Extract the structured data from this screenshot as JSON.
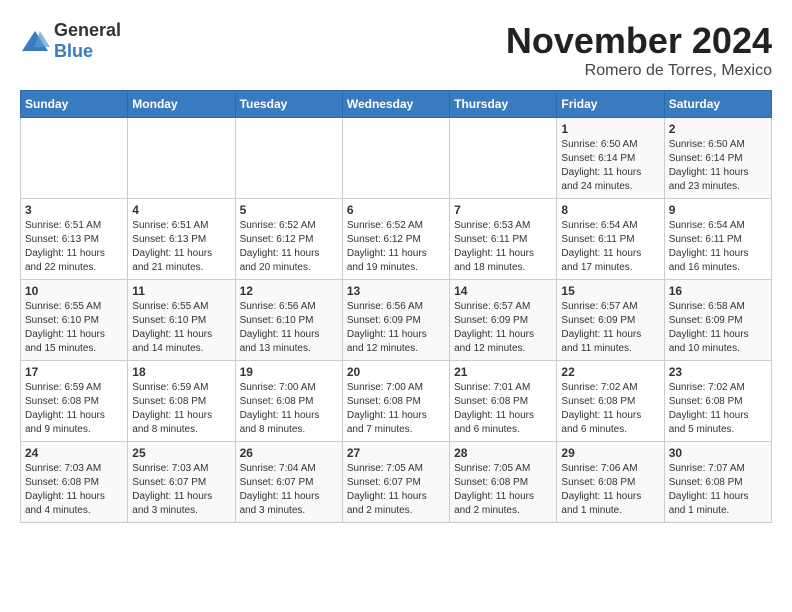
{
  "header": {
    "logo_general": "General",
    "logo_blue": "Blue",
    "month": "November 2024",
    "location": "Romero de Torres, Mexico"
  },
  "days_of_week": [
    "Sunday",
    "Monday",
    "Tuesday",
    "Wednesday",
    "Thursday",
    "Friday",
    "Saturday"
  ],
  "weeks": [
    [
      {
        "day": "",
        "info": ""
      },
      {
        "day": "",
        "info": ""
      },
      {
        "day": "",
        "info": ""
      },
      {
        "day": "",
        "info": ""
      },
      {
        "day": "",
        "info": ""
      },
      {
        "day": "1",
        "info": "Sunrise: 6:50 AM\nSunset: 6:14 PM\nDaylight: 11 hours and 24 minutes."
      },
      {
        "day": "2",
        "info": "Sunrise: 6:50 AM\nSunset: 6:14 PM\nDaylight: 11 hours and 23 minutes."
      }
    ],
    [
      {
        "day": "3",
        "info": "Sunrise: 6:51 AM\nSunset: 6:13 PM\nDaylight: 11 hours and 22 minutes."
      },
      {
        "day": "4",
        "info": "Sunrise: 6:51 AM\nSunset: 6:13 PM\nDaylight: 11 hours and 21 minutes."
      },
      {
        "day": "5",
        "info": "Sunrise: 6:52 AM\nSunset: 6:12 PM\nDaylight: 11 hours and 20 minutes."
      },
      {
        "day": "6",
        "info": "Sunrise: 6:52 AM\nSunset: 6:12 PM\nDaylight: 11 hours and 19 minutes."
      },
      {
        "day": "7",
        "info": "Sunrise: 6:53 AM\nSunset: 6:11 PM\nDaylight: 11 hours and 18 minutes."
      },
      {
        "day": "8",
        "info": "Sunrise: 6:54 AM\nSunset: 6:11 PM\nDaylight: 11 hours and 17 minutes."
      },
      {
        "day": "9",
        "info": "Sunrise: 6:54 AM\nSunset: 6:11 PM\nDaylight: 11 hours and 16 minutes."
      }
    ],
    [
      {
        "day": "10",
        "info": "Sunrise: 6:55 AM\nSunset: 6:10 PM\nDaylight: 11 hours and 15 minutes."
      },
      {
        "day": "11",
        "info": "Sunrise: 6:55 AM\nSunset: 6:10 PM\nDaylight: 11 hours and 14 minutes."
      },
      {
        "day": "12",
        "info": "Sunrise: 6:56 AM\nSunset: 6:10 PM\nDaylight: 11 hours and 13 minutes."
      },
      {
        "day": "13",
        "info": "Sunrise: 6:56 AM\nSunset: 6:09 PM\nDaylight: 11 hours and 12 minutes."
      },
      {
        "day": "14",
        "info": "Sunrise: 6:57 AM\nSunset: 6:09 PM\nDaylight: 11 hours and 12 minutes."
      },
      {
        "day": "15",
        "info": "Sunrise: 6:57 AM\nSunset: 6:09 PM\nDaylight: 11 hours and 11 minutes."
      },
      {
        "day": "16",
        "info": "Sunrise: 6:58 AM\nSunset: 6:09 PM\nDaylight: 11 hours and 10 minutes."
      }
    ],
    [
      {
        "day": "17",
        "info": "Sunrise: 6:59 AM\nSunset: 6:08 PM\nDaylight: 11 hours and 9 minutes."
      },
      {
        "day": "18",
        "info": "Sunrise: 6:59 AM\nSunset: 6:08 PM\nDaylight: 11 hours and 8 minutes."
      },
      {
        "day": "19",
        "info": "Sunrise: 7:00 AM\nSunset: 6:08 PM\nDaylight: 11 hours and 8 minutes."
      },
      {
        "day": "20",
        "info": "Sunrise: 7:00 AM\nSunset: 6:08 PM\nDaylight: 11 hours and 7 minutes."
      },
      {
        "day": "21",
        "info": "Sunrise: 7:01 AM\nSunset: 6:08 PM\nDaylight: 11 hours and 6 minutes."
      },
      {
        "day": "22",
        "info": "Sunrise: 7:02 AM\nSunset: 6:08 PM\nDaylight: 11 hours and 6 minutes."
      },
      {
        "day": "23",
        "info": "Sunrise: 7:02 AM\nSunset: 6:08 PM\nDaylight: 11 hours and 5 minutes."
      }
    ],
    [
      {
        "day": "24",
        "info": "Sunrise: 7:03 AM\nSunset: 6:08 PM\nDaylight: 11 hours and 4 minutes."
      },
      {
        "day": "25",
        "info": "Sunrise: 7:03 AM\nSunset: 6:07 PM\nDaylight: 11 hours and 3 minutes."
      },
      {
        "day": "26",
        "info": "Sunrise: 7:04 AM\nSunset: 6:07 PM\nDaylight: 11 hours and 3 minutes."
      },
      {
        "day": "27",
        "info": "Sunrise: 7:05 AM\nSunset: 6:07 PM\nDaylight: 11 hours and 2 minutes."
      },
      {
        "day": "28",
        "info": "Sunrise: 7:05 AM\nSunset: 6:08 PM\nDaylight: 11 hours and 2 minutes."
      },
      {
        "day": "29",
        "info": "Sunrise: 7:06 AM\nSunset: 6:08 PM\nDaylight: 11 hours and 1 minute."
      },
      {
        "day": "30",
        "info": "Sunrise: 7:07 AM\nSunset: 6:08 PM\nDaylight: 11 hours and 1 minute."
      }
    ]
  ]
}
